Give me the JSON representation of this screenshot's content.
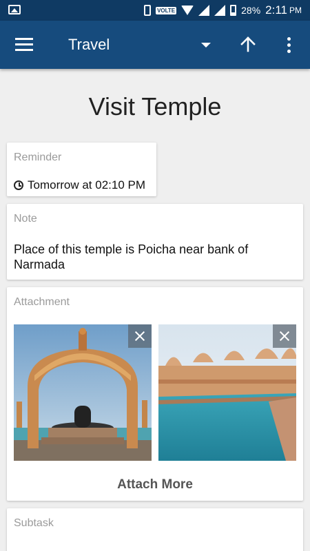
{
  "status_bar": {
    "volte": "VOLTE",
    "battery": "28%",
    "time": "2:11",
    "ampm": "PM"
  },
  "app_bar": {
    "title": "Travel"
  },
  "page": {
    "title": "Visit Temple"
  },
  "reminder": {
    "label": "Reminder",
    "value": "Tomorrow at 02:10 PM"
  },
  "note": {
    "label": "Note",
    "text": "Place of this temple is Poicha near bank of Narmada"
  },
  "attachment": {
    "label": "Attachment",
    "images": [
      "temple-arch-photo",
      "temple-water-photo"
    ],
    "attach_more": "Attach More"
  },
  "subtask": {
    "label": "Subtask"
  }
}
